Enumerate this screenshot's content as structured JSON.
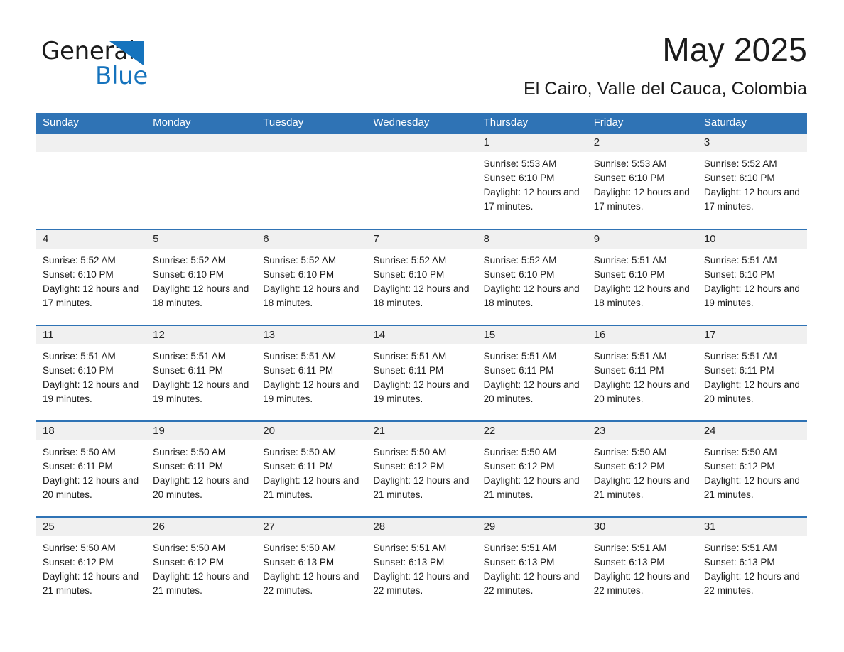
{
  "brand": {
    "name_part1": "General",
    "name_part2": "Blue",
    "accent_color": "#1573bd",
    "logo_icon": "triangle-flag-icon"
  },
  "header": {
    "month_title": "May 2025",
    "location": "El Cairo, Valle del Cauca, Colombia"
  },
  "theme": {
    "header_blue": "#2f73b5",
    "daynum_band": "#f0f0f0",
    "text": "#1b1b1b"
  },
  "calendar": {
    "weekday_headers": [
      "Sunday",
      "Monday",
      "Tuesday",
      "Wednesday",
      "Thursday",
      "Friday",
      "Saturday"
    ],
    "weeks": [
      [
        {
          "day": "",
          "details": ""
        },
        {
          "day": "",
          "details": ""
        },
        {
          "day": "",
          "details": ""
        },
        {
          "day": "",
          "details": ""
        },
        {
          "day": "1",
          "details": "Sunrise: 5:53 AM\nSunset: 6:10 PM\nDaylight: 12 hours and 17 minutes."
        },
        {
          "day": "2",
          "details": "Sunrise: 5:53 AM\nSunset: 6:10 PM\nDaylight: 12 hours and 17 minutes."
        },
        {
          "day": "3",
          "details": "Sunrise: 5:52 AM\nSunset: 6:10 PM\nDaylight: 12 hours and 17 minutes."
        }
      ],
      [
        {
          "day": "4",
          "details": "Sunrise: 5:52 AM\nSunset: 6:10 PM\nDaylight: 12 hours and 17 minutes."
        },
        {
          "day": "5",
          "details": "Sunrise: 5:52 AM\nSunset: 6:10 PM\nDaylight: 12 hours and 18 minutes."
        },
        {
          "day": "6",
          "details": "Sunrise: 5:52 AM\nSunset: 6:10 PM\nDaylight: 12 hours and 18 minutes."
        },
        {
          "day": "7",
          "details": "Sunrise: 5:52 AM\nSunset: 6:10 PM\nDaylight: 12 hours and 18 minutes."
        },
        {
          "day": "8",
          "details": "Sunrise: 5:52 AM\nSunset: 6:10 PM\nDaylight: 12 hours and 18 minutes."
        },
        {
          "day": "9",
          "details": "Sunrise: 5:51 AM\nSunset: 6:10 PM\nDaylight: 12 hours and 18 minutes."
        },
        {
          "day": "10",
          "details": "Sunrise: 5:51 AM\nSunset: 6:10 PM\nDaylight: 12 hours and 19 minutes."
        }
      ],
      [
        {
          "day": "11",
          "details": "Sunrise: 5:51 AM\nSunset: 6:10 PM\nDaylight: 12 hours and 19 minutes."
        },
        {
          "day": "12",
          "details": "Sunrise: 5:51 AM\nSunset: 6:11 PM\nDaylight: 12 hours and 19 minutes."
        },
        {
          "day": "13",
          "details": "Sunrise: 5:51 AM\nSunset: 6:11 PM\nDaylight: 12 hours and 19 minutes."
        },
        {
          "day": "14",
          "details": "Sunrise: 5:51 AM\nSunset: 6:11 PM\nDaylight: 12 hours and 19 minutes."
        },
        {
          "day": "15",
          "details": "Sunrise: 5:51 AM\nSunset: 6:11 PM\nDaylight: 12 hours and 20 minutes."
        },
        {
          "day": "16",
          "details": "Sunrise: 5:51 AM\nSunset: 6:11 PM\nDaylight: 12 hours and 20 minutes."
        },
        {
          "day": "17",
          "details": "Sunrise: 5:51 AM\nSunset: 6:11 PM\nDaylight: 12 hours and 20 minutes."
        }
      ],
      [
        {
          "day": "18",
          "details": "Sunrise: 5:50 AM\nSunset: 6:11 PM\nDaylight: 12 hours and 20 minutes."
        },
        {
          "day": "19",
          "details": "Sunrise: 5:50 AM\nSunset: 6:11 PM\nDaylight: 12 hours and 20 minutes."
        },
        {
          "day": "20",
          "details": "Sunrise: 5:50 AM\nSunset: 6:11 PM\nDaylight: 12 hours and 21 minutes."
        },
        {
          "day": "21",
          "details": "Sunrise: 5:50 AM\nSunset: 6:12 PM\nDaylight: 12 hours and 21 minutes."
        },
        {
          "day": "22",
          "details": "Sunrise: 5:50 AM\nSunset: 6:12 PM\nDaylight: 12 hours and 21 minutes."
        },
        {
          "day": "23",
          "details": "Sunrise: 5:50 AM\nSunset: 6:12 PM\nDaylight: 12 hours and 21 minutes."
        },
        {
          "day": "24",
          "details": "Sunrise: 5:50 AM\nSunset: 6:12 PM\nDaylight: 12 hours and 21 minutes."
        }
      ],
      [
        {
          "day": "25",
          "details": "Sunrise: 5:50 AM\nSunset: 6:12 PM\nDaylight: 12 hours and 21 minutes."
        },
        {
          "day": "26",
          "details": "Sunrise: 5:50 AM\nSunset: 6:12 PM\nDaylight: 12 hours and 21 minutes."
        },
        {
          "day": "27",
          "details": "Sunrise: 5:50 AM\nSunset: 6:13 PM\nDaylight: 12 hours and 22 minutes."
        },
        {
          "day": "28",
          "details": "Sunrise: 5:51 AM\nSunset: 6:13 PM\nDaylight: 12 hours and 22 minutes."
        },
        {
          "day": "29",
          "details": "Sunrise: 5:51 AM\nSunset: 6:13 PM\nDaylight: 12 hours and 22 minutes."
        },
        {
          "day": "30",
          "details": "Sunrise: 5:51 AM\nSunset: 6:13 PM\nDaylight: 12 hours and 22 minutes."
        },
        {
          "day": "31",
          "details": "Sunrise: 5:51 AM\nSunset: 6:13 PM\nDaylight: 12 hours and 22 minutes."
        }
      ]
    ]
  }
}
